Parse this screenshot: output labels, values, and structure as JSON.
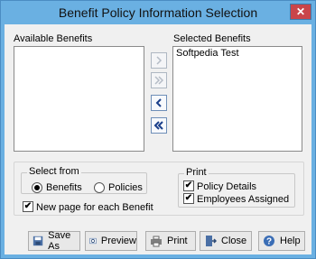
{
  "window": {
    "title": "Benefit Policy Information Selection",
    "close_glyph": "✕"
  },
  "available": {
    "label": "Available Benefits",
    "items": []
  },
  "selected": {
    "label": "Selected Benefits",
    "items": [
      "Softpedia Test"
    ]
  },
  "select_from": {
    "title": "Select from",
    "options": [
      {
        "label": "Benefits",
        "checked": true
      },
      {
        "label": "Policies",
        "checked": false
      }
    ]
  },
  "new_page": {
    "label": "New page for each Benefit",
    "checked": true
  },
  "print_group": {
    "title": "Print",
    "options": [
      {
        "label": "Policy Details",
        "checked": true
      },
      {
        "label": "Employees Assigned",
        "checked": true
      }
    ]
  },
  "buttons": {
    "save_as": "Save As",
    "preview": "Preview",
    "print": "Print",
    "close": "Close",
    "help": "Help"
  },
  "check_glyph": "✔"
}
